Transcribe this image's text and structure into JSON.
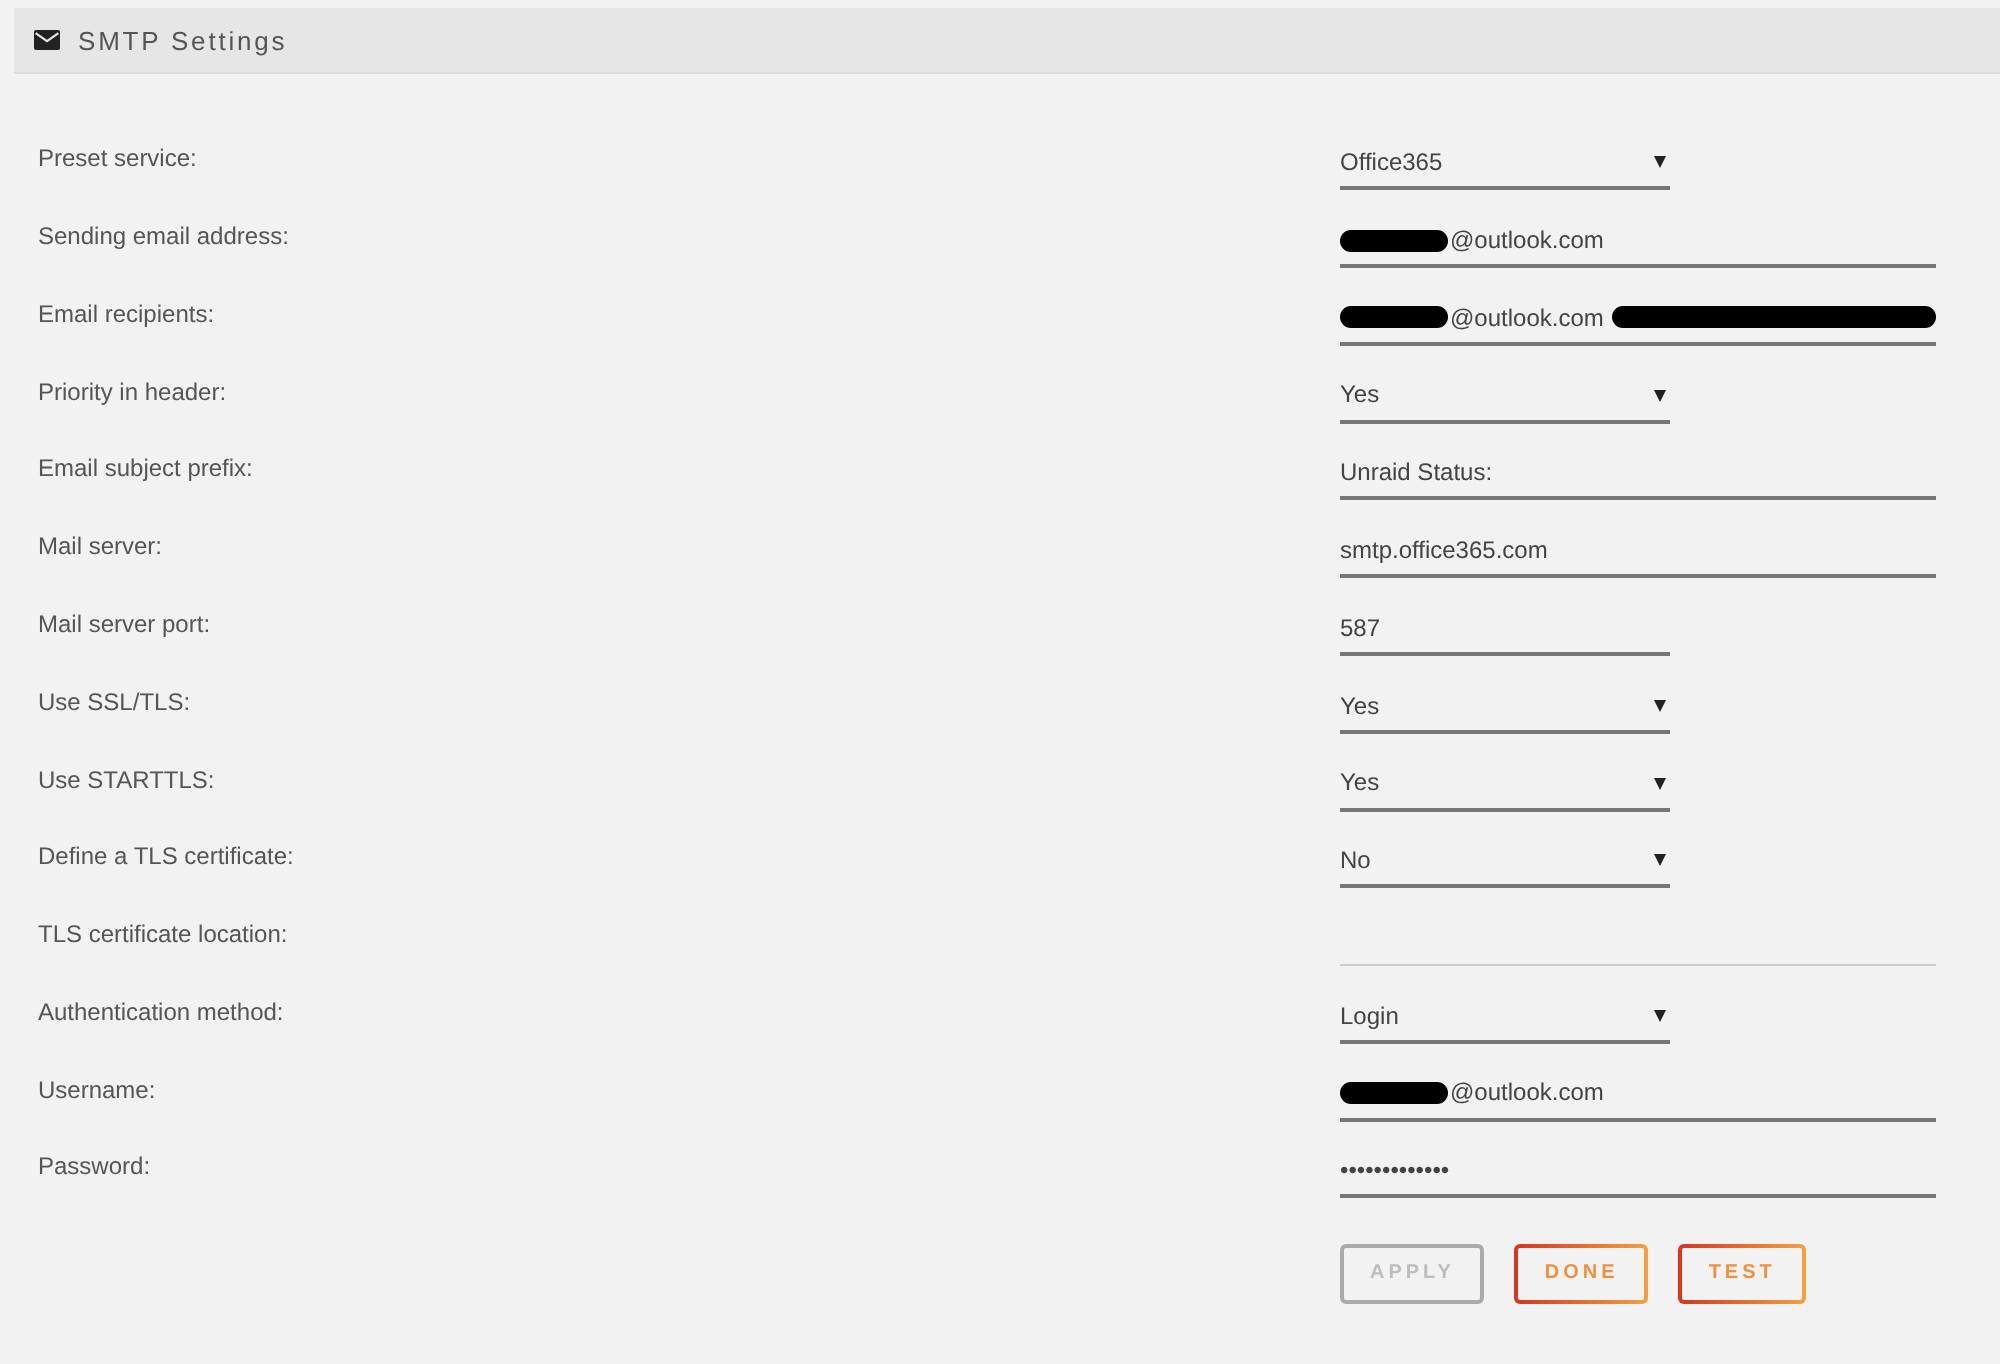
{
  "panel": {
    "title": "SMTP Settings"
  },
  "fields": [
    {
      "label": "Preset service:",
      "kind": "select",
      "value": "Office365",
      "disabled": false
    },
    {
      "label": "Sending email address:",
      "kind": "text",
      "value_parts": [
        {
          "kind": "redaction"
        },
        {
          "kind": "text",
          "text": "@outlook.com"
        }
      ],
      "disabled": false
    },
    {
      "label": "Email recipients:",
      "kind": "text",
      "value_parts": [
        {
          "kind": "redaction"
        },
        {
          "kind": "text",
          "text": "@outlook.com"
        },
        {
          "kind": "redaction"
        }
      ],
      "disabled": false
    },
    {
      "label": "Priority in header:",
      "kind": "select",
      "value": "Yes",
      "disabled": false
    },
    {
      "label": "Email subject prefix:",
      "kind": "text",
      "value": "Unraid Status:",
      "disabled": false
    },
    {
      "label": "Mail server:",
      "kind": "text",
      "value": "smtp.office365.com",
      "disabled": false
    },
    {
      "label": "Mail server port:",
      "kind": "number",
      "value": "587",
      "disabled": false
    },
    {
      "label": "Use SSL/TLS:",
      "kind": "select",
      "value": "Yes",
      "disabled": false
    },
    {
      "label": "Use STARTTLS:",
      "kind": "select",
      "value": "Yes",
      "disabled": false
    },
    {
      "label": "Define a TLS certificate:",
      "kind": "select",
      "value": "No",
      "disabled": false
    },
    {
      "label": "TLS certificate location:",
      "kind": "text",
      "disabled": true
    },
    {
      "label": "Authentication method:",
      "kind": "select",
      "value": "Login",
      "disabled": false
    },
    {
      "label": "Username:",
      "kind": "text",
      "value_parts": [
        {
          "kind": "redaction"
        },
        {
          "kind": "text",
          "text": "@outlook.com"
        }
      ],
      "disabled": false
    },
    {
      "label": "Password:",
      "kind": "password",
      "value": "•••••••••••••",
      "disabled": false
    }
  ],
  "buttons": [
    {
      "label": "APPLY",
      "disabled": true
    },
    {
      "label": "DONE",
      "disabled": false
    },
    {
      "label": "TEST",
      "disabled": false
    }
  ]
}
